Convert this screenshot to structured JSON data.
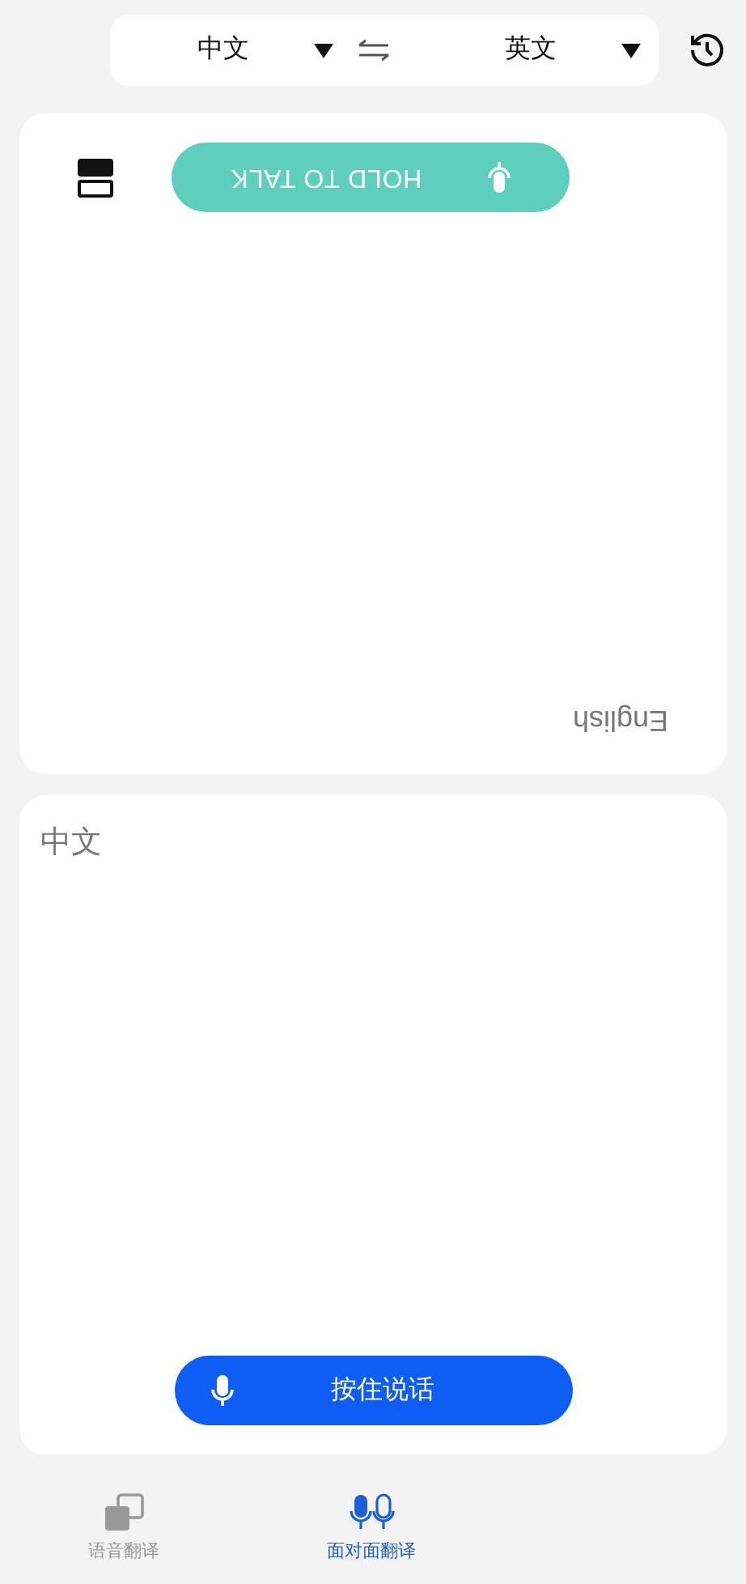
{
  "language_bar": {
    "source": "中文",
    "target": "英文"
  },
  "top_panel": {
    "button_label": "HOLD TO TALK",
    "language_label": "English"
  },
  "bottom_panel": {
    "language_label": "中文",
    "button_label": "按住说话"
  },
  "nav_tabs": [
    {
      "label": "语音翻译",
      "kind": "translate",
      "selected": false
    },
    {
      "label": "面对面翻译",
      "kind": "face",
      "selected": true
    }
  ]
}
